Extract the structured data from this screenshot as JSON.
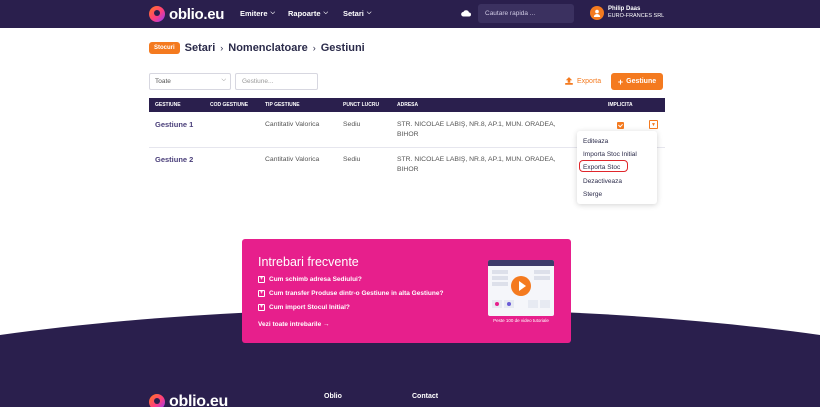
{
  "header": {
    "logo_text": "oblio.eu",
    "nav": [
      {
        "label": "Emitere"
      },
      {
        "label": "Rapoarte"
      },
      {
        "label": "Setari"
      }
    ],
    "search_placeholder": "Cautare rapida ...",
    "user_name": "Philip Daas",
    "user_company": "EURO-FRANCES SRL"
  },
  "breadcrumb": {
    "badge": "Stocuri",
    "items": [
      "Setari",
      "Nomenclatoare",
      "Gestiuni"
    ]
  },
  "filters": {
    "select_value": "Toate",
    "input_placeholder": "Gestiune..."
  },
  "actions": {
    "export_label": "Exporta",
    "add_label": "Gestiune"
  },
  "table": {
    "headers": [
      "GESTIUNE",
      "COD GESTIUNE",
      "TIP GESTIUNE",
      "PUNCT LUCRU",
      "ADRESA",
      "IMPLICITA"
    ],
    "rows": [
      {
        "name": "Gestiune 1",
        "cod": "",
        "tip": "Cantitativ Valorica",
        "punct": "Sediu",
        "adresa_l1": "STR. NICOLAE LABIŞ, NR.8, AP.1, MUN. ORADEA,",
        "adresa_l2": "BIHOR",
        "implicita": true
      },
      {
        "name": "Gestiune 2",
        "cod": "",
        "tip": "Cantitativ Valorica",
        "punct": "Sediu",
        "adresa_l1": "STR. NICOLAE LABIŞ, NR.8, AP.1, MUN. ORADEA,",
        "adresa_l2": "BIHOR",
        "implicita": false
      }
    ]
  },
  "row_menu": {
    "items": [
      "Editeaza",
      "Importa Stoc Initial",
      "Exporta Stoc",
      "Dezactiveaza",
      "Sterge"
    ],
    "highlighted": "Exporta Stoc"
  },
  "faq": {
    "title": "Intrebari frecvente",
    "questions": [
      "Cum schimb adresa Sediului?",
      "Cum transfer Produse dintr-o Gestiune in alta Gestiune?",
      "Cum import Stocul Initial?"
    ],
    "all_link": "Vezi toate intrebarile",
    "video_caption": "Peste 100 de video tutoriale"
  },
  "footer": {
    "logo_text": "oblio.eu",
    "links": [
      "Oblio",
      "Contact"
    ]
  },
  "colors": {
    "brand_dark": "#2a1f4d",
    "accent": "#f47a1f",
    "faq_pink": "#e71f8c",
    "highlight_red": "#e0262b"
  }
}
